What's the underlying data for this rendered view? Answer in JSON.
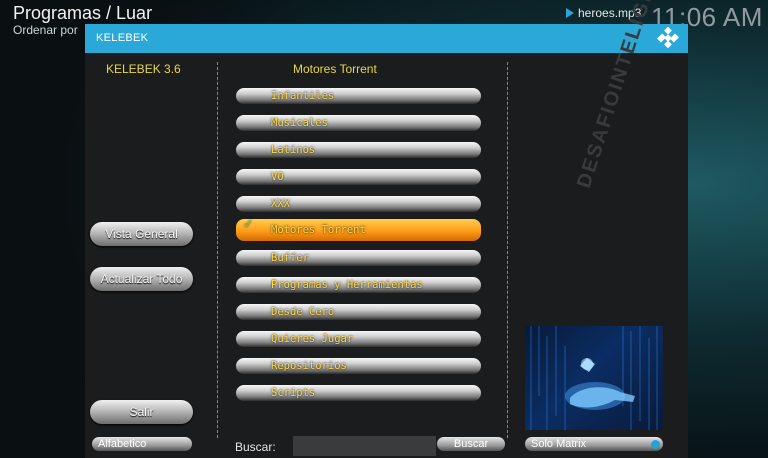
{
  "header": {
    "title": "Programas / Luar",
    "subtitle": "Ordenar por",
    "now_playing": "heroes.mp3",
    "clock": "11:06 AM"
  },
  "dialog": {
    "title": "KELEBEK",
    "version": "KELEBEK 3.6",
    "category_header": "Motores Torrent"
  },
  "left_buttons": {
    "overview": "Vista General",
    "update_all": "Actualizar Todo",
    "exit": "Salir",
    "alphabetical": "Alfabetico"
  },
  "menu": {
    "items": [
      {
        "label": "Infantiles"
      },
      {
        "label": "Musicales"
      },
      {
        "label": "Latinos"
      },
      {
        "label": "VO"
      },
      {
        "label": "XXX"
      },
      {
        "label": "Motores Torrent",
        "selected": true
      },
      {
        "label": "Buffer"
      },
      {
        "label": "Programas y Herramientas"
      },
      {
        "label": "Desde Cero"
      },
      {
        "label": "Quieres Jugar"
      },
      {
        "label": "Repositorios"
      },
      {
        "label": "Scripts"
      }
    ]
  },
  "search": {
    "label": "Buscar:",
    "value": "",
    "button": "Buscar"
  },
  "toggle": {
    "label": "Solo Matrix",
    "on": true
  },
  "watermark": "DESAFIOINTELIGENTE.COM",
  "colors": {
    "titlebar": "#2aa9d9",
    "accent_text": "#e7d64a",
    "selected": "#ff9c1a",
    "check": "#7dd14a"
  }
}
